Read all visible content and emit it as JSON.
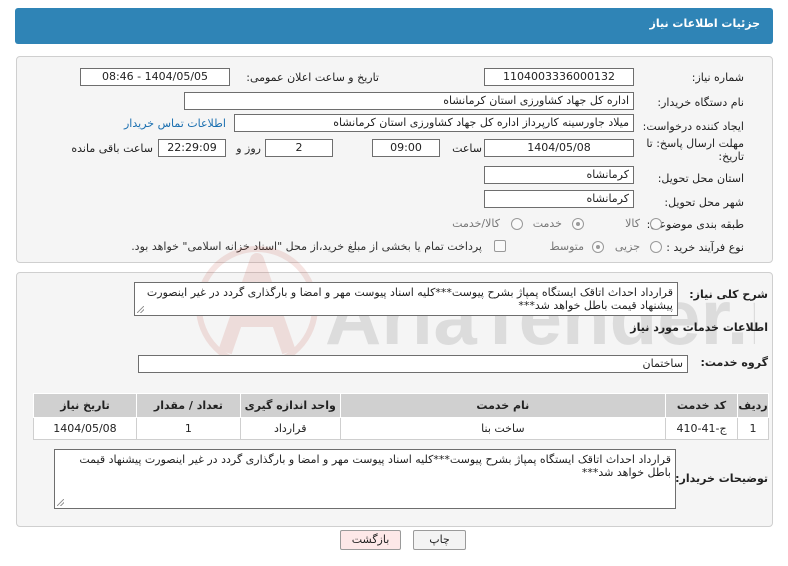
{
  "page_title": "جزئیات اطلاعات نیاز",
  "fields": {
    "need_number_label": "شماره نیاز:",
    "need_number": "1104003336000132",
    "announce_label": "تاریخ و ساعت اعلان عمومی:",
    "announce_value": "1404/05/05 - 08:46",
    "buyer_org_label": "نام دستگاه خریدار:",
    "buyer_org": "اداره کل جهاد کشاورزی استان کرمانشاه",
    "creator_label": "ایجاد کننده درخواست:",
    "creator": "میلاد جاورسینه کارپرداز اداره کل جهاد کشاورزی استان کرمانشاه",
    "buyer_contact_link": "اطلاعات تماس خریدار",
    "deadline_label": "مهلت ارسال پاسخ: تا تاریخ:",
    "deadline_date": "1404/05/08",
    "time_label": "ساعت",
    "deadline_time": "09:00",
    "days_value": "2",
    "days_label": "روز و",
    "remaining_time": "22:29:09",
    "remaining_label": "ساعت باقی مانده",
    "province_label": "استان محل تحویل:",
    "province": "کرمانشاه",
    "city_label": "شهر محل تحویل:",
    "city": "کرمانشاه",
    "category_label": "طبقه بندی موضوعی:",
    "category_options": [
      "کالا",
      "خدمت",
      "کالا/خدمت"
    ],
    "process_label": "نوع فرآیند خرید :",
    "process_options": [
      "جزیی",
      "متوسط"
    ],
    "payment_note": "پرداخت تمام یا بخشی از مبلغ خرید،از محل \"اسناد خزانه اسلامی\" خواهد بود."
  },
  "summary": {
    "label": "شرح کلی نیاز:",
    "text": "قرارداد احداث اتاقک ایستگاه پمپاژ بشرح پیوست***کلیه اسناد پیوست مهر و امضا و بارگذاری گردد در غیر اینصورت پیشنهاد قیمت باطل خواهد شد***"
  },
  "services": {
    "section_title": "اطلاعات خدمات مورد نیاز",
    "group_label": "گروه خدمت:",
    "group_value": "ساختمان",
    "columns": [
      "ردیف",
      "کد خدمت",
      "نام خدمت",
      "واحد اندازه گیری",
      "تعداد / مقدار",
      "تاریخ نیاز"
    ],
    "rows": [
      [
        "1",
        "ج-41-410",
        "ساخت بنا",
        "قرارداد",
        "1",
        "1404/05/08"
      ]
    ]
  },
  "buyer_notes": {
    "label": "توضیحات خریدار:",
    "text": "قرارداد احداث اتاقک ایستگاه پمپاژ بشرح پیوست***کلیه اسناد پیوست مهر و امضا و بارگذاری گردد در غیر اینصورت پیشنهاد قیمت باطل خواهد شد***"
  },
  "buttons": {
    "print": "چاپ",
    "back": "بازگشت"
  },
  "watermark": "AriaTender.neT",
  "colors": {
    "header_bg": "#2f84b6",
    "link": "#1a6fb0",
    "table_header": "#d0d0d0",
    "back_button_bg": "#fde8e8"
  }
}
